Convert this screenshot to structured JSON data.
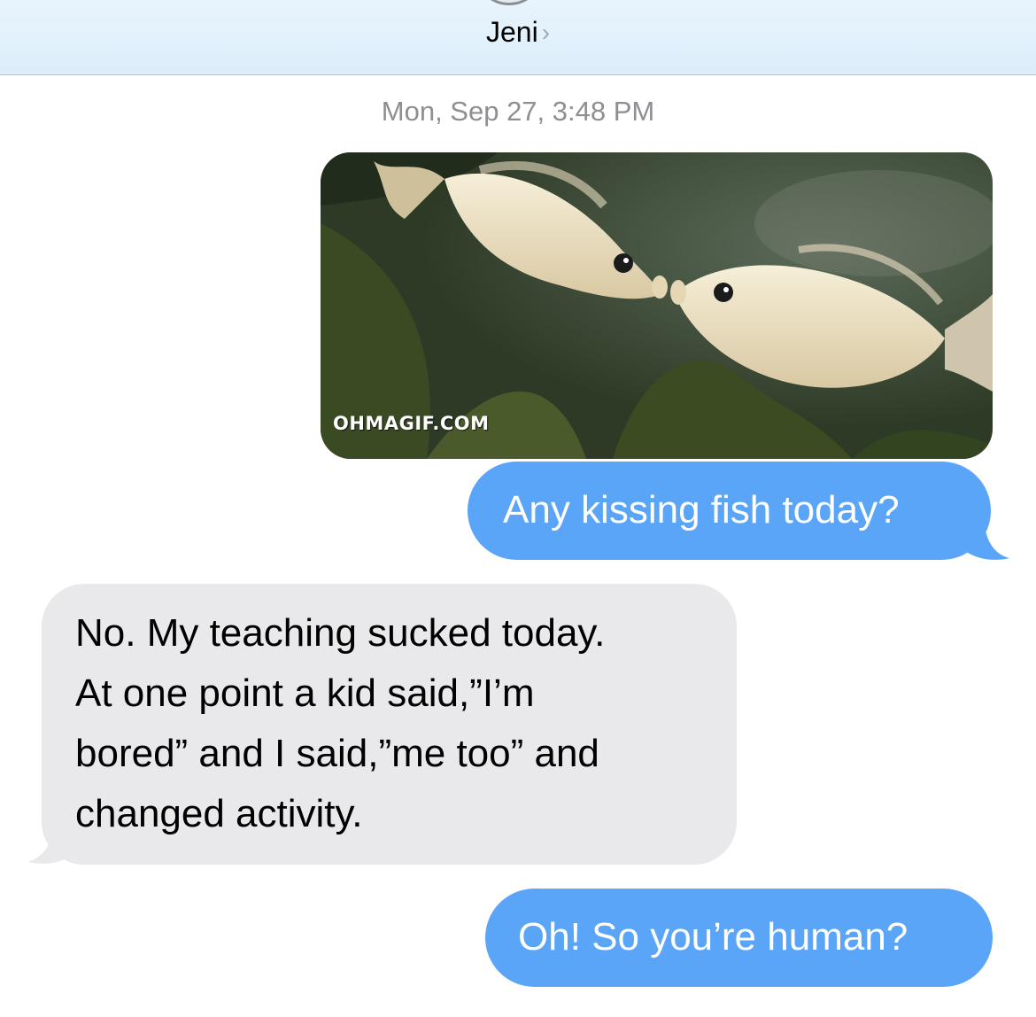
{
  "header": {
    "contact_name": "Jeni",
    "chevron": "›"
  },
  "thread": {
    "timestamp": "Mon, Sep 27, 3:48 PM",
    "media": {
      "watermark": "OHMAGIF.COM"
    },
    "messages": [
      {
        "direction": "outgoing",
        "lines": [
          "Any kissing fish today?"
        ]
      },
      {
        "direction": "incoming",
        "lines": [
          "No. My teaching sucked today.",
          "At one point a kid said,”I’m",
          "bored” and I said,”me too” and",
          "changed activity."
        ]
      },
      {
        "direction": "outgoing",
        "lines": [
          "Oh! So you’re human?"
        ]
      }
    ]
  },
  "colors": {
    "outgoing_bubble": "#5aa5f7",
    "incoming_bubble": "#e9e9eb",
    "header_bg": "#e2f0fb",
    "timestamp_text": "#8e8e93"
  }
}
